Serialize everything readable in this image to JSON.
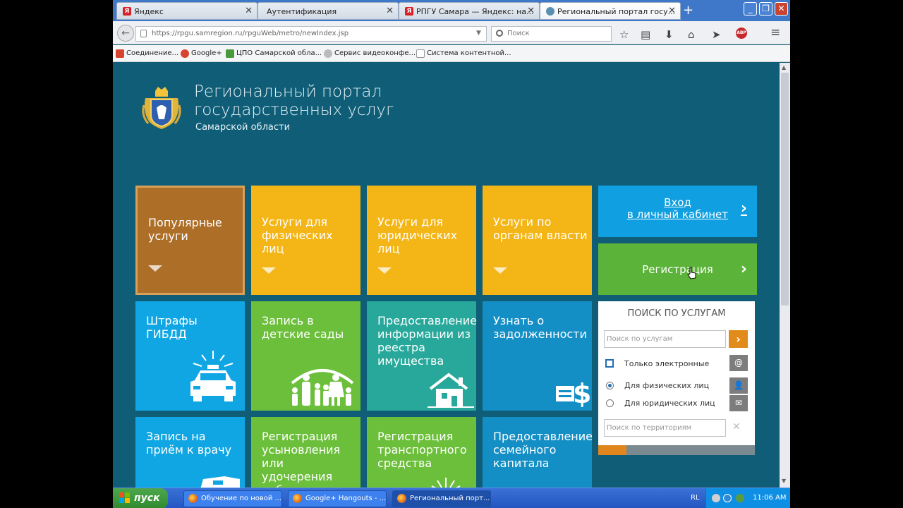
{
  "browser": {
    "tabs": [
      {
        "label": "Яндекс",
        "favicon": "yandex-icon"
      },
      {
        "label": "Аутентификация",
        "favicon": ""
      },
      {
        "label": "РПГУ Самара — Яндекс: на...",
        "favicon": "yandex-icon"
      },
      {
        "label": "Региональный портал госу...",
        "favicon": "emblem-icon"
      }
    ],
    "url": "https://rpgu.samregion.ru/rpguWeb/metro/newIndex.jsp",
    "search_placeholder": "Поиск",
    "bookmarks": [
      {
        "label": "Соединение...",
        "color": "#d8432f"
      },
      {
        "label": "Google+",
        "color": "#d8432f"
      },
      {
        "label": "ЦПО Самарской обла...",
        "color": "#4a9a3d"
      },
      {
        "label": "Сервис видеоконфе...",
        "color": "#999999"
      },
      {
        "label": "Система контентной...",
        "color": "#ffffff"
      }
    ]
  },
  "header": {
    "title_line1": "Региональный портал",
    "title_line2": "государственных услуг",
    "subtitle": "Самарской области"
  },
  "tiles": {
    "popular": "Популярные услуги",
    "individuals": "Услуги для физических лиц",
    "legal": "Услуги для юридических лиц",
    "authorities": "Услуги по органам власти",
    "fines": "Штрафы ГИБДД",
    "kindergarten": "Запись в детские сады",
    "property": "Предоставление информации из реестра имущества",
    "debt": "Узнать о задолженности",
    "doctor": "Запись на приём к врачу",
    "adoption": "Регистрация усыновления или удочерения ребенка",
    "vehicle": "Регистрация транспортного средства",
    "family_capital": "Предоставление семейного капитала"
  },
  "side": {
    "login_line1": "Вход",
    "login_line2": "в личный кабинет",
    "register": "Регистрация"
  },
  "search_panel": {
    "title": "ПОИСК ПО УСЛУГАМ",
    "search_placeholder": "Поиск по услугам",
    "opt_electronic": "Только электронные",
    "opt_individuals": "Для физических лиц",
    "opt_legal": "Для юридических лиц",
    "territory_placeholder": "Поиск по территориям",
    "progress": 0.18
  },
  "taskbar": {
    "start": "пуск",
    "items": [
      "Обучение по новой ...",
      "Google+ Hangouts - ...",
      "Региональный порт..."
    ],
    "lang": "RL",
    "clock": "11:06 AM"
  },
  "colors": {
    "page_bg": "#0f5d77",
    "yellow": "#f4b516",
    "popular": "#ad6e28",
    "blue": "#10a6e3",
    "green": "#6cbf3b",
    "teal": "#27a89a",
    "orange": "#e18b1a"
  }
}
